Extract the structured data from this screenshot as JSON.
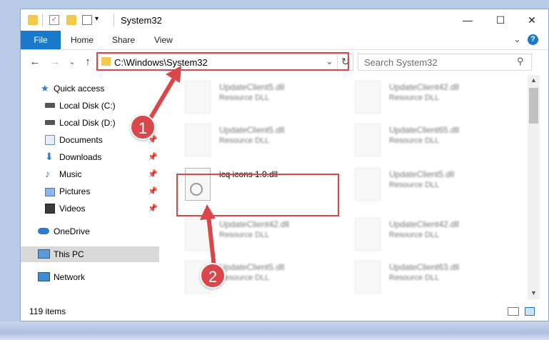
{
  "window": {
    "title": "System32",
    "minimize": "—",
    "maximize": "☐",
    "close": "✕"
  },
  "ribbon": {
    "tabs": [
      "File",
      "Home",
      "Share",
      "View"
    ],
    "expand": "⌄",
    "help": "?"
  },
  "nav": {
    "back": "←",
    "forward": "→",
    "recent": "⌄",
    "up": "↑",
    "address": "C:\\Windows\\System32",
    "dropdown": "⌄",
    "refresh": "↻",
    "search_placeholder": "Search System32",
    "search_icon": "⚲"
  },
  "sidebar": {
    "items": [
      {
        "label": "Quick access",
        "icon": "star-icon"
      },
      {
        "label": "Local Disk (C:)",
        "icon": "drive-icon"
      },
      {
        "label": "Local Disk (D:)",
        "icon": "drive-icon"
      },
      {
        "label": "Documents",
        "icon": "documents-icon",
        "pinned": true
      },
      {
        "label": "Downloads",
        "icon": "download-icon",
        "pinned": true
      },
      {
        "label": "Music",
        "icon": "music-icon",
        "pinned": true
      },
      {
        "label": "Pictures",
        "icon": "pictures-icon",
        "pinned": true
      },
      {
        "label": "Videos",
        "icon": "videos-icon",
        "pinned": true
      },
      {
        "label": "OneDrive",
        "icon": "cloud-icon"
      },
      {
        "label": "This PC",
        "icon": "computer-icon",
        "selected": true
      },
      {
        "label": "Network",
        "icon": "network-icon"
      }
    ],
    "pin_glyph": "📌"
  },
  "files": [
    {
      "name": "UpdateClient5.dll",
      "type": "Resource DLL"
    },
    {
      "name": "UpdateClient42.dll",
      "type": "Resource DLL"
    },
    {
      "name": "UpdateClient5.dll",
      "type": "Resource DLL"
    },
    {
      "name": "UpdateClient65.dll",
      "type": "Resource DLL"
    },
    {
      "name": "icq icons 1.0.dll",
      "type": ""
    },
    {
      "name": "UpdateClient5.dll",
      "type": "Resource DLL"
    },
    {
      "name": "UpdateClient42.dll",
      "type": "Resource DLL"
    },
    {
      "name": "UpdateClient42.dll",
      "type": "Resource DLL"
    },
    {
      "name": "UpdateClient5.dll",
      "type": "Resource DLL"
    },
    {
      "name": "UpdateClient63.dll",
      "type": "Resource DLL"
    }
  ],
  "status": {
    "items": "119 items"
  },
  "annotations": {
    "step1": "1",
    "step2": "2"
  },
  "colors": {
    "accent": "#1979ca",
    "highlight": "#d9474a",
    "folder": "#f3c94b"
  }
}
